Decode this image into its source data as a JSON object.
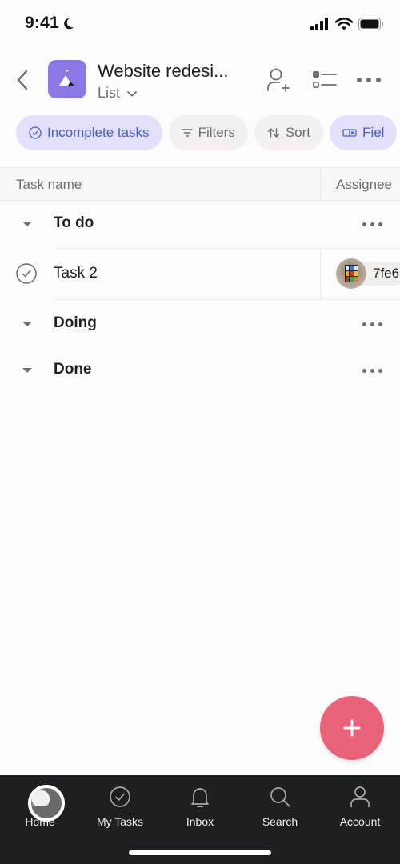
{
  "status_bar": {
    "time": "9:41",
    "icons": [
      "moon-icon",
      "cellular-signal-icon",
      "wifi-icon",
      "battery-icon"
    ]
  },
  "header": {
    "back_icon": "chevron-left-icon",
    "project_icon": "mountain-flag-icon",
    "project_color": "#8b78e6",
    "title": "Website redesi...",
    "view_label": "List",
    "view_dropdown_icon": "chevron-down-icon",
    "actions": [
      "add-member-icon",
      "view-options-icon",
      "more-icon"
    ]
  },
  "chips": [
    {
      "label": "Incomplete tasks",
      "icon": "check-circle-icon",
      "active": true
    },
    {
      "label": "Filters",
      "icon": "filter-icon",
      "active": false
    },
    {
      "label": "Sort",
      "icon": "sort-icon",
      "active": false
    },
    {
      "label": "Fiel",
      "icon": "fields-icon",
      "active": true
    }
  ],
  "table": {
    "columns": [
      "Task name",
      "Assignee"
    ],
    "sections": [
      {
        "title": "To do",
        "tasks": [
          {
            "name": "Task 2",
            "assignee": "7fe6",
            "completed": false
          }
        ]
      },
      {
        "title": "Doing",
        "tasks": []
      },
      {
        "title": "Done",
        "tasks": []
      }
    ]
  },
  "fab": {
    "icon": "plus-icon",
    "color": "#e8627a"
  },
  "bottom_nav": {
    "items": [
      {
        "label": "Home",
        "icon": "home-icon"
      },
      {
        "label": "My Tasks",
        "icon": "check-circle-icon"
      },
      {
        "label": "Inbox",
        "icon": "bell-icon"
      },
      {
        "label": "Search",
        "icon": "search-icon"
      },
      {
        "label": "Account",
        "icon": "person-icon"
      }
    ]
  }
}
